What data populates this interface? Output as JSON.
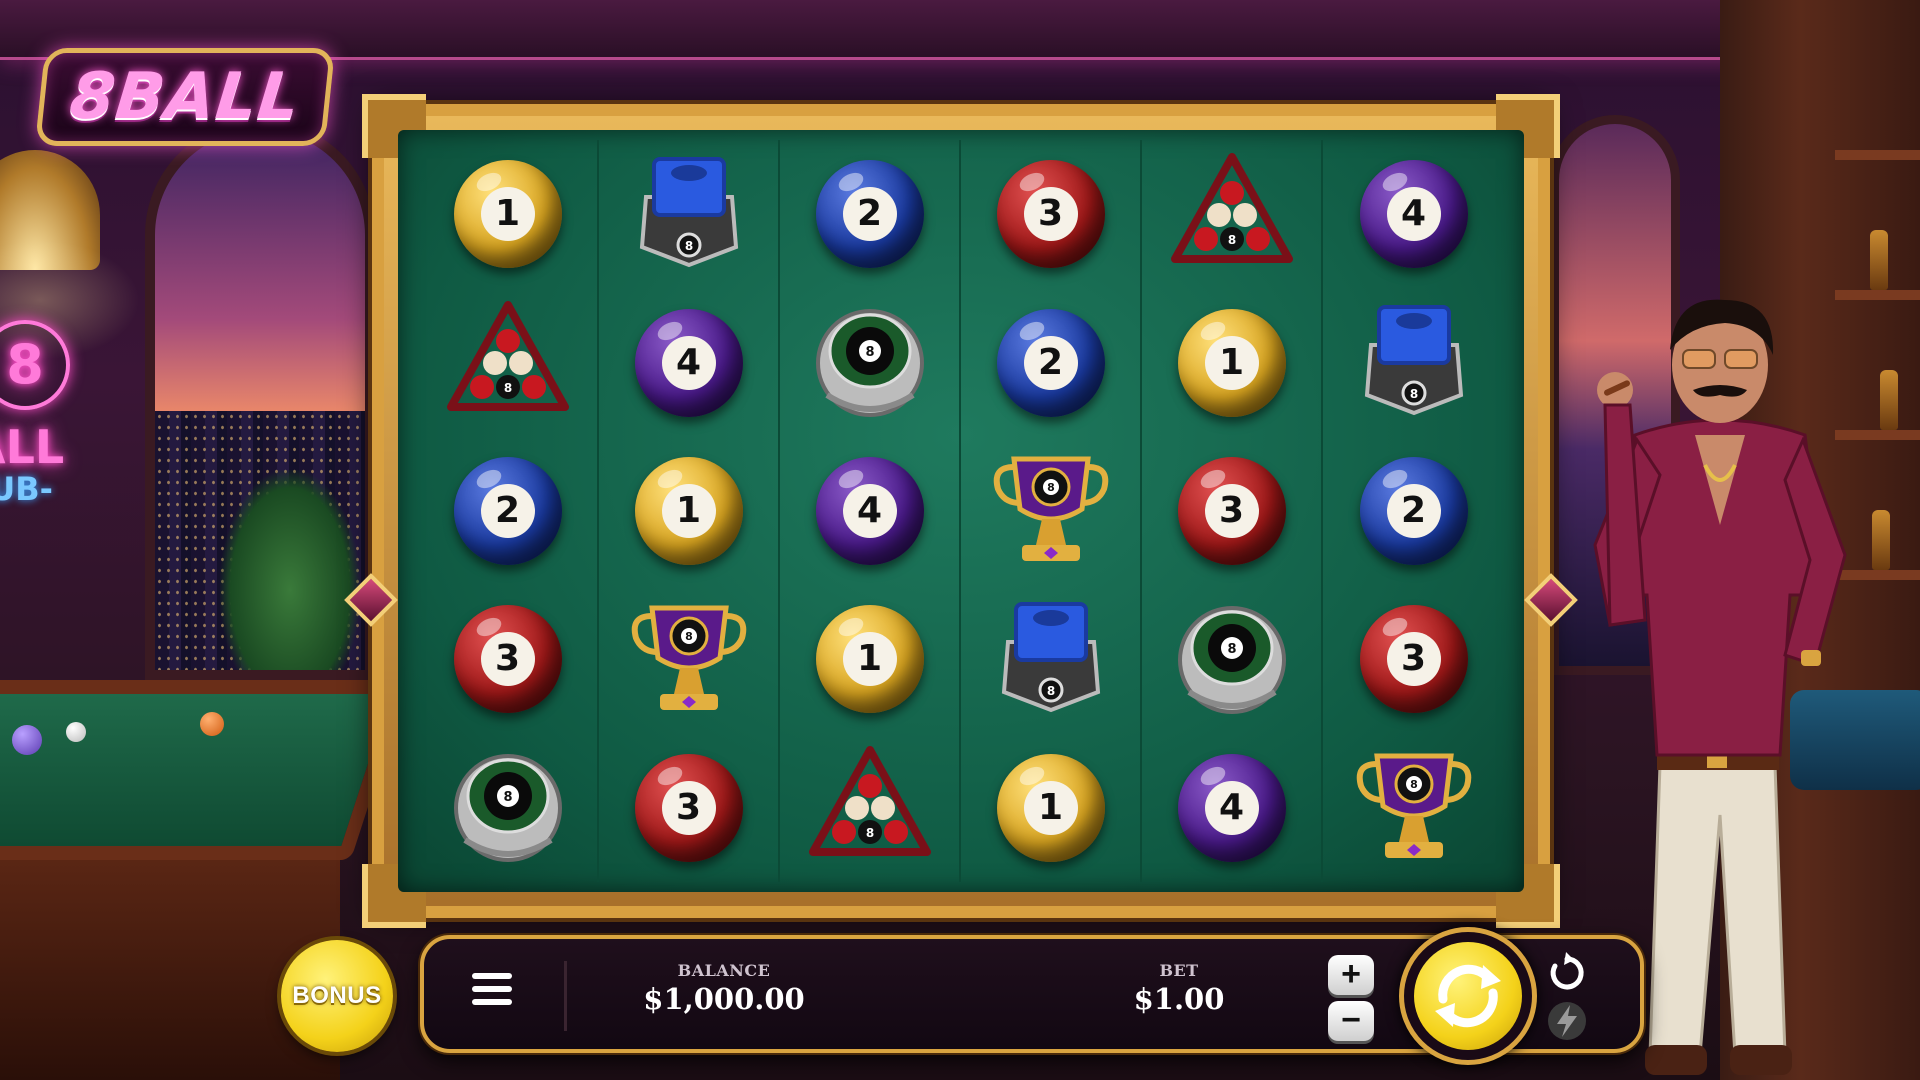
{
  "game": {
    "logo_text": "8BALL"
  },
  "background": {
    "neon_sign_number": "8",
    "neon_sign_line1": "ALL",
    "neon_sign_line2": "LUB-"
  },
  "reels": [
    [
      "ball-1",
      "rack",
      "ball-2",
      "ball-3",
      "ring"
    ],
    [
      "chalk",
      "ball-4",
      "ball-1",
      "trophy",
      "ball-3"
    ],
    [
      "ball-2",
      "ring",
      "ball-4",
      "ball-1",
      "rack"
    ],
    [
      "ball-3",
      "ball-2",
      "trophy",
      "chalk",
      "ball-1"
    ],
    [
      "rack",
      "ball-1",
      "ball-3",
      "ring",
      "ball-4"
    ],
    [
      "ball-4",
      "chalk",
      "ball-2",
      "ball-3",
      "trophy"
    ]
  ],
  "symbol_labels": {
    "ball-1": "1",
    "ball-2": "2",
    "ball-3": "3",
    "ball-4": "4"
  },
  "controls": {
    "bonus_label": "BONUS",
    "balance_label": "BALANCE",
    "balance_value": "$1,000.00",
    "bet_label": "BET",
    "bet_value": "$1.00",
    "plus_label": "+",
    "minus_label": "−",
    "menu_icon": "hamburger-icon",
    "spin_icon": "spin-arrows-icon",
    "autoplay_icon": "autoplay-icon",
    "turbo_icon": "lightning-icon"
  },
  "colors": {
    "frame_gold": "#d8a040",
    "felt_green": "#0f5a43",
    "spin_yellow": "#f4d21a",
    "neon_pink": "#ff7ad9"
  }
}
